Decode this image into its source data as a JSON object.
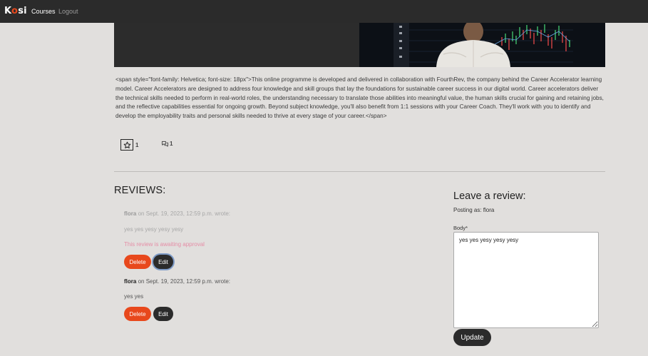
{
  "navbar": {
    "brand_prefix": "K",
    "brand_accent": "o",
    "brand_suffix": "si",
    "links": [
      "Courses",
      "Logout"
    ]
  },
  "course": {
    "description": "<span style=\"font-family: Helvetica; font-size: 18px\">This online programme is developed and delivered in collaboration with FourthRev, the company behind the Career Accelerator learning model. Career Accelerators are designed to address four knowledge and skill groups that lay the foundations for sustainable career success in our digital world. Career accelerators deliver the technical skills needed to perform in real-world roles, the understanding necessary to translate those abilities into meaningful value, the human skills crucial for gaining and retaining jobs, and the reflective capabilities essential for ongoing growth. Beyond subject knowledge, you'll also benefit from 1:1 sessions with your Career Coach. They'll work with you to identify and develop the employability traits and personal skills needed to thrive at every stage of your career.</span>",
    "star_count": "1",
    "comment_count": "1"
  },
  "reviews": {
    "title": "REVIEWS:",
    "items": [
      {
        "author": "flora",
        "meta": " on Sept. 19, 2023, 12:59 p.m. wrote:",
        "body": "yes yes yesy yesy yesy",
        "status": "This review is awaiting approval",
        "delete_label": "Delete",
        "edit_label": "Edit"
      },
      {
        "author": "flora",
        "meta": " on Sept. 19, 2023, 12:59 p.m. wrote:",
        "body": "yes yes",
        "delete_label": "Delete",
        "edit_label": "Edit"
      }
    ]
  },
  "review_form": {
    "title": "Leave a review:",
    "posting_as": "Posting as: flora",
    "body_label": "Body*",
    "body_value": "yes yes yesy yesy yesy",
    "submit_label": "Update"
  },
  "colors": {
    "accent": "#e8481c",
    "navbar": "#2b2b2b",
    "background": "#e1dfdd",
    "pending": "#e58da6"
  },
  "icons": {
    "star": "star-icon",
    "comments": "comments-icon"
  }
}
